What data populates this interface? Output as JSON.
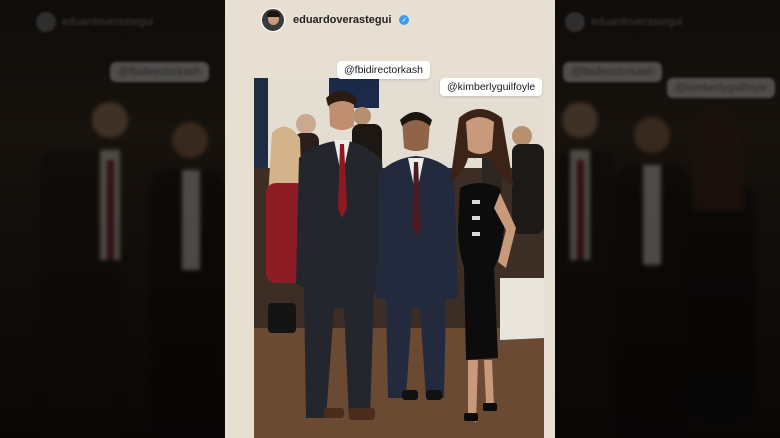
{
  "story": {
    "username": "eduardoverastegui",
    "verified": true
  },
  "tags": [
    {
      "label": "@fbidirectorkash"
    },
    {
      "label": "@kimberlyguilfoyle"
    }
  ],
  "icons": {
    "verified": "verified-badge-icon"
  },
  "colors": {
    "story_background": "#e8dfd3",
    "verified_blue": "#3d9bf0",
    "tag_background": "#ffffff"
  }
}
